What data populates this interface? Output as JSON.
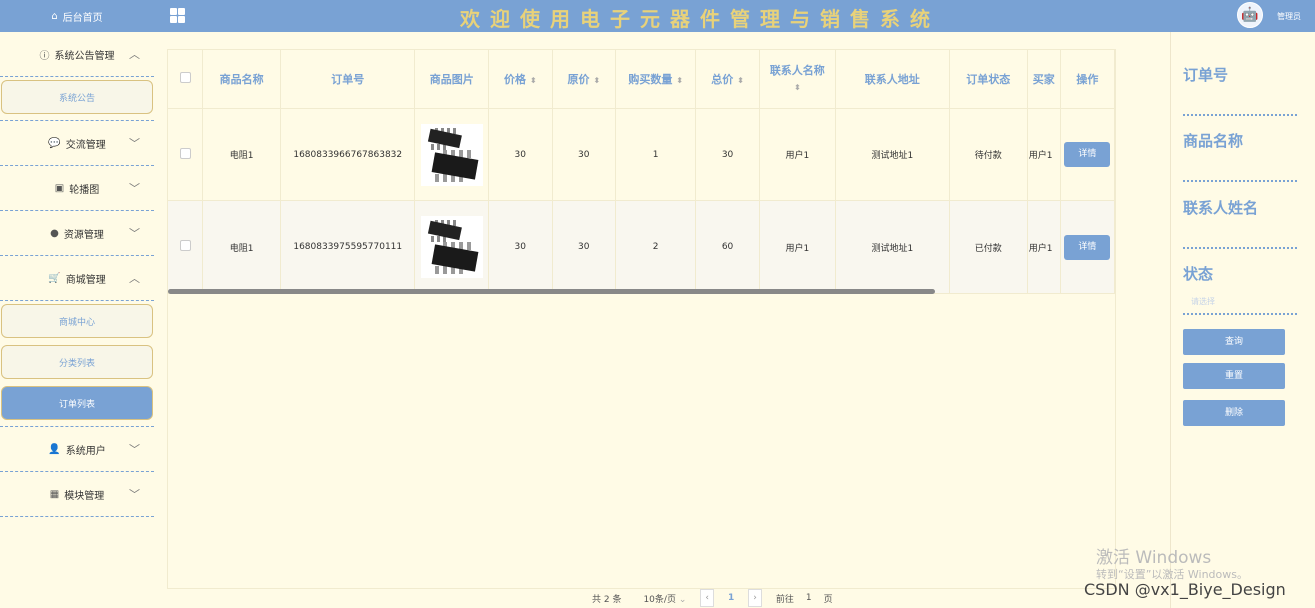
{
  "sidebar": {
    "home": "后台首页",
    "groups": [
      {
        "label": "系统公告管理",
        "subs": [
          "系统公告"
        ]
      },
      {
        "label": "交流管理"
      },
      {
        "label": "轮播图"
      },
      {
        "label": "资源管理"
      },
      {
        "label": "商城管理",
        "subs": [
          "商城中心",
          "分类列表",
          "订单列表"
        ]
      },
      {
        "label": "系统用户"
      },
      {
        "label": "模块管理"
      }
    ]
  },
  "header": {
    "title": "欢迎使用电子元器件管理与销售系统",
    "user": "管理员"
  },
  "table": {
    "headers": [
      "商品名称",
      "订单号",
      "商品图片",
      "价格",
      "原价",
      "购买数量",
      "总价",
      "联系人名称",
      "联系人地址",
      "订单状态",
      "买家",
      "操作"
    ],
    "rows": [
      {
        "name": "电阻1",
        "order_no": "1680833966767863832",
        "price": "30",
        "orig_price": "30",
        "qty": "1",
        "total": "30",
        "contact": "用户1",
        "address": "测试地址1",
        "status": "待付款",
        "buyer": "用户1",
        "action": "详情"
      },
      {
        "name": "电阻1",
        "order_no": "1680833975595770111",
        "price": "30",
        "orig_price": "30",
        "qty": "2",
        "total": "60",
        "contact": "用户1",
        "address": "测试地址1",
        "status": "已付款",
        "buyer": "用户1",
        "action": "详情"
      }
    ]
  },
  "filter": {
    "labels": [
      "订单号",
      "商品名称",
      "联系人姓名",
      "状态"
    ],
    "select_placeholder": "请选择",
    "buttons": [
      "查询",
      "重置",
      "删除"
    ]
  },
  "pager": {
    "total": "共 2 条",
    "page_size": "10条/页",
    "prev": "‹",
    "current": "1",
    "next": "›",
    "goto": "前往",
    "goto_value": "1",
    "page_unit": "页"
  },
  "watermark": {
    "line1": "激活 Windows",
    "line2": "转到“设置”以激活 Windows。",
    "csdn": "CSDN @vx1_Biye_Design"
  },
  "colors": {
    "accent": "#79a2d4",
    "background": "#fffbe6",
    "title": "#e8d27a"
  }
}
